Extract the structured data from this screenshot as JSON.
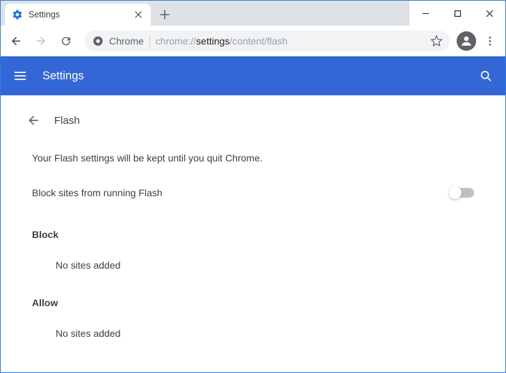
{
  "window": {
    "tab_title": "Settings"
  },
  "toolbar": {
    "chrome_chip": "Chrome",
    "url_prefix": "chrome://",
    "url_strong": "settings",
    "url_suffix": "/content/flash"
  },
  "appbar": {
    "title": "Settings"
  },
  "page": {
    "heading": "Flash",
    "info": "Your Flash settings will be kept until you quit Chrome.",
    "toggle_label": "Block sites from running Flash",
    "toggle_on": false,
    "block_header": "Block",
    "block_empty": "No sites added",
    "allow_header": "Allow",
    "allow_empty": "No sites added"
  }
}
